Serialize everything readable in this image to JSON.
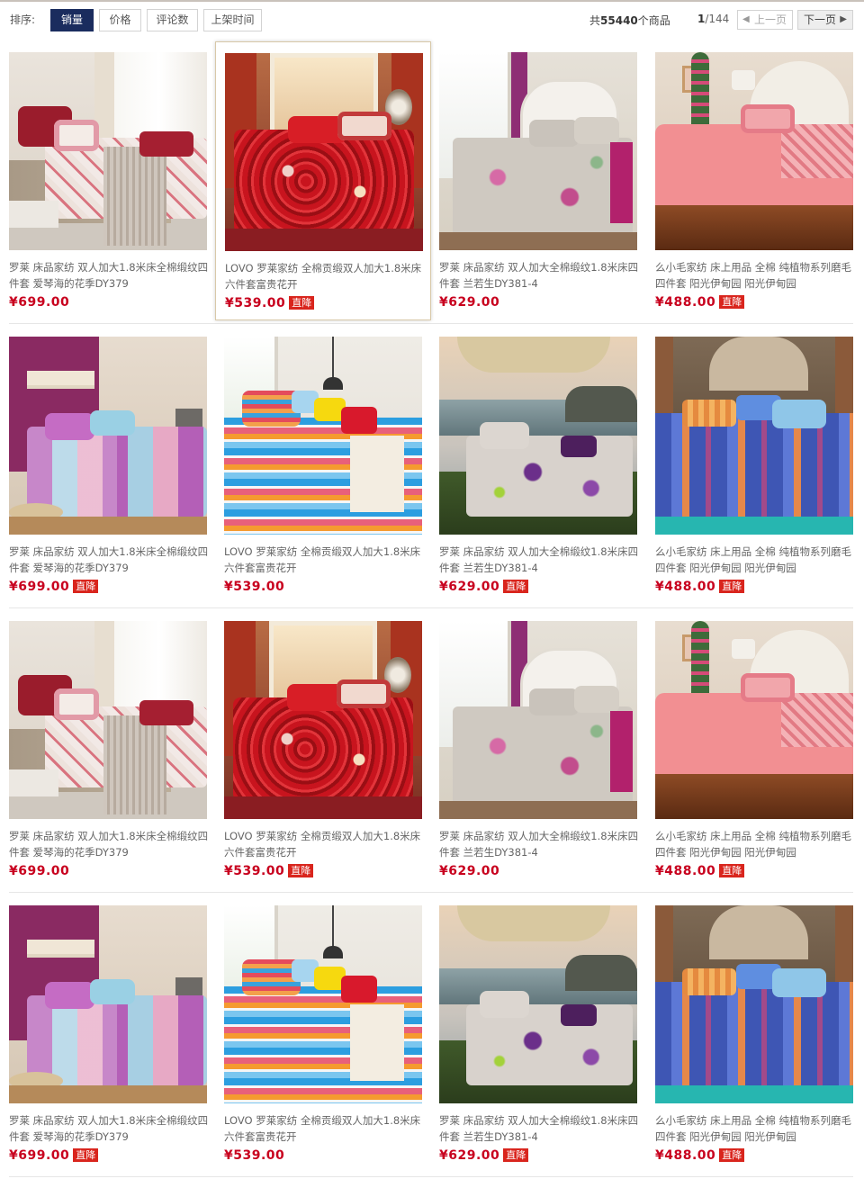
{
  "sort": {
    "label": "排序:",
    "options": [
      "销量",
      "价格",
      "评论数",
      "上架时间"
    ],
    "active": "销量"
  },
  "summary": {
    "prefix": "共",
    "count": "55440",
    "suffix": "个商品"
  },
  "pager": {
    "current": "1",
    "total": "/144",
    "prev_label": "上一页",
    "next_label": "下一页"
  },
  "badge_label": "直降",
  "products": [
    {
      "title": "罗莱 床品家纺 双人加大1.8米床全棉缎纹四件套 爱琴海的花季DY379",
      "price": "¥699.00",
      "badge": false,
      "photo": "burgundy-floral"
    },
    {
      "title": "LOVO 罗莱家纺 全棉贡缎双人加大1.8米床六件套富贵花开",
      "price": "¥539.00",
      "badge": true,
      "photo": "red-floral"
    },
    {
      "title": "罗莱 床品家纺 双人加大全棉缎纹1.8米床四件套 兰若生DY381-4",
      "price": "¥629.00",
      "badge": false,
      "photo": "grey-peony"
    },
    {
      "title": "么小毛家纺 床上用品 全棉 纯植物系列磨毛 四件套 阳光伊甸园 阳光伊甸园",
      "price": "¥488.00",
      "badge": true,
      "photo": "pink-plain"
    },
    {
      "title": "罗莱 床品家纺 双人加大1.8米床全棉缎纹四件套 爱琴海的花季DY379",
      "price": "¥699.00",
      "badge": true,
      "photo": "purple-check"
    },
    {
      "title": "LOVO 罗莱家纺 全棉贡缎双人加大1.8米床六件套富贵花开",
      "price": "¥539.00",
      "badge": false,
      "photo": "rainbow-stripe"
    },
    {
      "title": "罗莱 床品家纺 双人加大全棉缎纹1.8米床四件套 兰若生DY381-4",
      "price": "¥629.00",
      "badge": true,
      "photo": "seaside-violet"
    },
    {
      "title": "么小毛家纺 床上用品 全棉 纯植物系列磨毛 四件套 阳光伊甸园 阳光伊甸园",
      "price": "¥488.00",
      "badge": true,
      "photo": "blue-paisley"
    },
    {
      "title": "罗莱 床品家纺 双人加大1.8米床全棉缎纹四件套 爱琴海的花季DY379",
      "price": "¥699.00",
      "badge": false,
      "photo": "burgundy-floral"
    },
    {
      "title": "LOVO 罗莱家纺 全棉贡缎双人加大1.8米床六件套富贵花开",
      "price": "¥539.00",
      "badge": true,
      "photo": "red-floral"
    },
    {
      "title": "罗莱 床品家纺 双人加大全棉缎纹1.8米床四件套 兰若生DY381-4",
      "price": "¥629.00",
      "badge": false,
      "photo": "grey-peony"
    },
    {
      "title": "么小毛家纺 床上用品 全棉 纯植物系列磨毛 四件套 阳光伊甸园 阳光伊甸园",
      "price": "¥488.00",
      "badge": true,
      "photo": "pink-plain"
    },
    {
      "title": "罗莱 床品家纺 双人加大1.8米床全棉缎纹四件套 爱琴海的花季DY379",
      "price": "¥699.00",
      "badge": true,
      "photo": "purple-check"
    },
    {
      "title": "LOVO 罗莱家纺 全棉贡缎双人加大1.8米床六件套富贵花开",
      "price": "¥539.00",
      "badge": false,
      "photo": "rainbow-stripe"
    },
    {
      "title": "罗莱 床品家纺 双人加大全棉缎纹1.8米床四件套 兰若生DY381-4",
      "price": "¥629.00",
      "badge": true,
      "photo": "seaside-violet"
    },
    {
      "title": "么小毛家纺 床上用品 全棉 纯植物系列磨毛 四件套 阳光伊甸园 阳光伊甸园",
      "price": "¥488.00",
      "badge": true,
      "photo": "blue-paisley"
    }
  ],
  "colors": {
    "active_sort_bg": "#1a2c5e",
    "price": "#c8001e",
    "badge_bg": "#d9251d"
  }
}
